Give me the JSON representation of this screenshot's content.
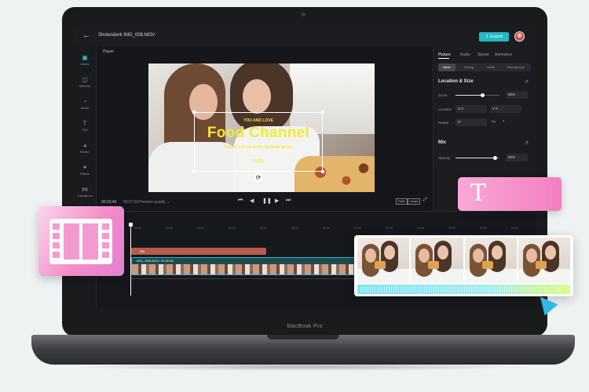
{
  "app": {
    "file_title": "Shotonderk IMG_008.MOV",
    "export_label": "Export",
    "back_icon": "back-arrow-icon"
  },
  "sidebar": {
    "items": [
      {
        "label": "Media",
        "icon": "media-icon",
        "glyph": "▣",
        "active": true
      },
      {
        "label": "Material",
        "icon": "material-icon",
        "glyph": "◫"
      },
      {
        "label": "Audio",
        "icon": "audio-icon",
        "glyph": "◔"
      },
      {
        "label": "Text",
        "icon": "text-icon",
        "glyph": "T"
      },
      {
        "label": "Sticker",
        "icon": "sticker-icon",
        "glyph": "◕"
      },
      {
        "label": "Effects",
        "icon": "effects-icon",
        "glyph": "✦"
      },
      {
        "label": "Transitions",
        "icon": "transitions-icon",
        "glyph": "⋈"
      },
      {
        "label": "Filter",
        "icon": "filter-icon",
        "glyph": "◭"
      }
    ]
  },
  "player": {
    "label": "Player",
    "overlay_small": "YOU AND LOVE",
    "overlay_title": "Food Channel",
    "overlay_sub": "Today's food fanfi / favorite pizza",
    "overlay_vlog": "VLOG",
    "current_time": "00:03:45",
    "total_time": "00:57:50",
    "quality": "Preview quality ⌄",
    "ratio_label": "Ratio",
    "adapt_label": "Adapt"
  },
  "right_panel": {
    "tabs": [
      "Picture",
      "Audio",
      "Speed",
      "Animation"
    ],
    "active_tab": "Picture",
    "subtabs": [
      "Basic",
      "Keying",
      "Mask",
      "Background"
    ],
    "active_subtab": "Basic",
    "location_title": "Location & Size",
    "zoom_label": "Zoom",
    "zoom_value": "60%",
    "zoom_level": 0.6,
    "location_label": "Location",
    "location_x": "X  0",
    "location_y": "Y  0",
    "rotate_label": "Rotate",
    "rotate_value": "0°",
    "mix_title": "Mix",
    "opacity_label": "Opacity",
    "opacity_value": "90%",
    "opacity_level": 0.9
  },
  "timeline": {
    "ticks": [
      "00:00",
      "00:05",
      "00:10",
      "00:15",
      "00:20",
      "00:25",
      "00:30",
      "00:35",
      "00:40",
      "00:45",
      "00:50",
      "00:55",
      "01:00"
    ],
    "title_clip": "Title",
    "video_clip_name": "IMG_7836.MOV",
    "video_clip_duration": "00:00:56"
  },
  "device": {
    "brand": "MacBook Pro"
  },
  "colors": {
    "accent": "#22b8c4",
    "title_text": "#f3e838",
    "title_clip": "#b85b4c",
    "card_pink": "#f48cc8"
  },
  "floating": {
    "text_card_glyph": "T",
    "text_card_icon": "text-t-icon",
    "film_icon": "film-strip-icon",
    "cursor_icon": "pointer-cursor-icon"
  }
}
